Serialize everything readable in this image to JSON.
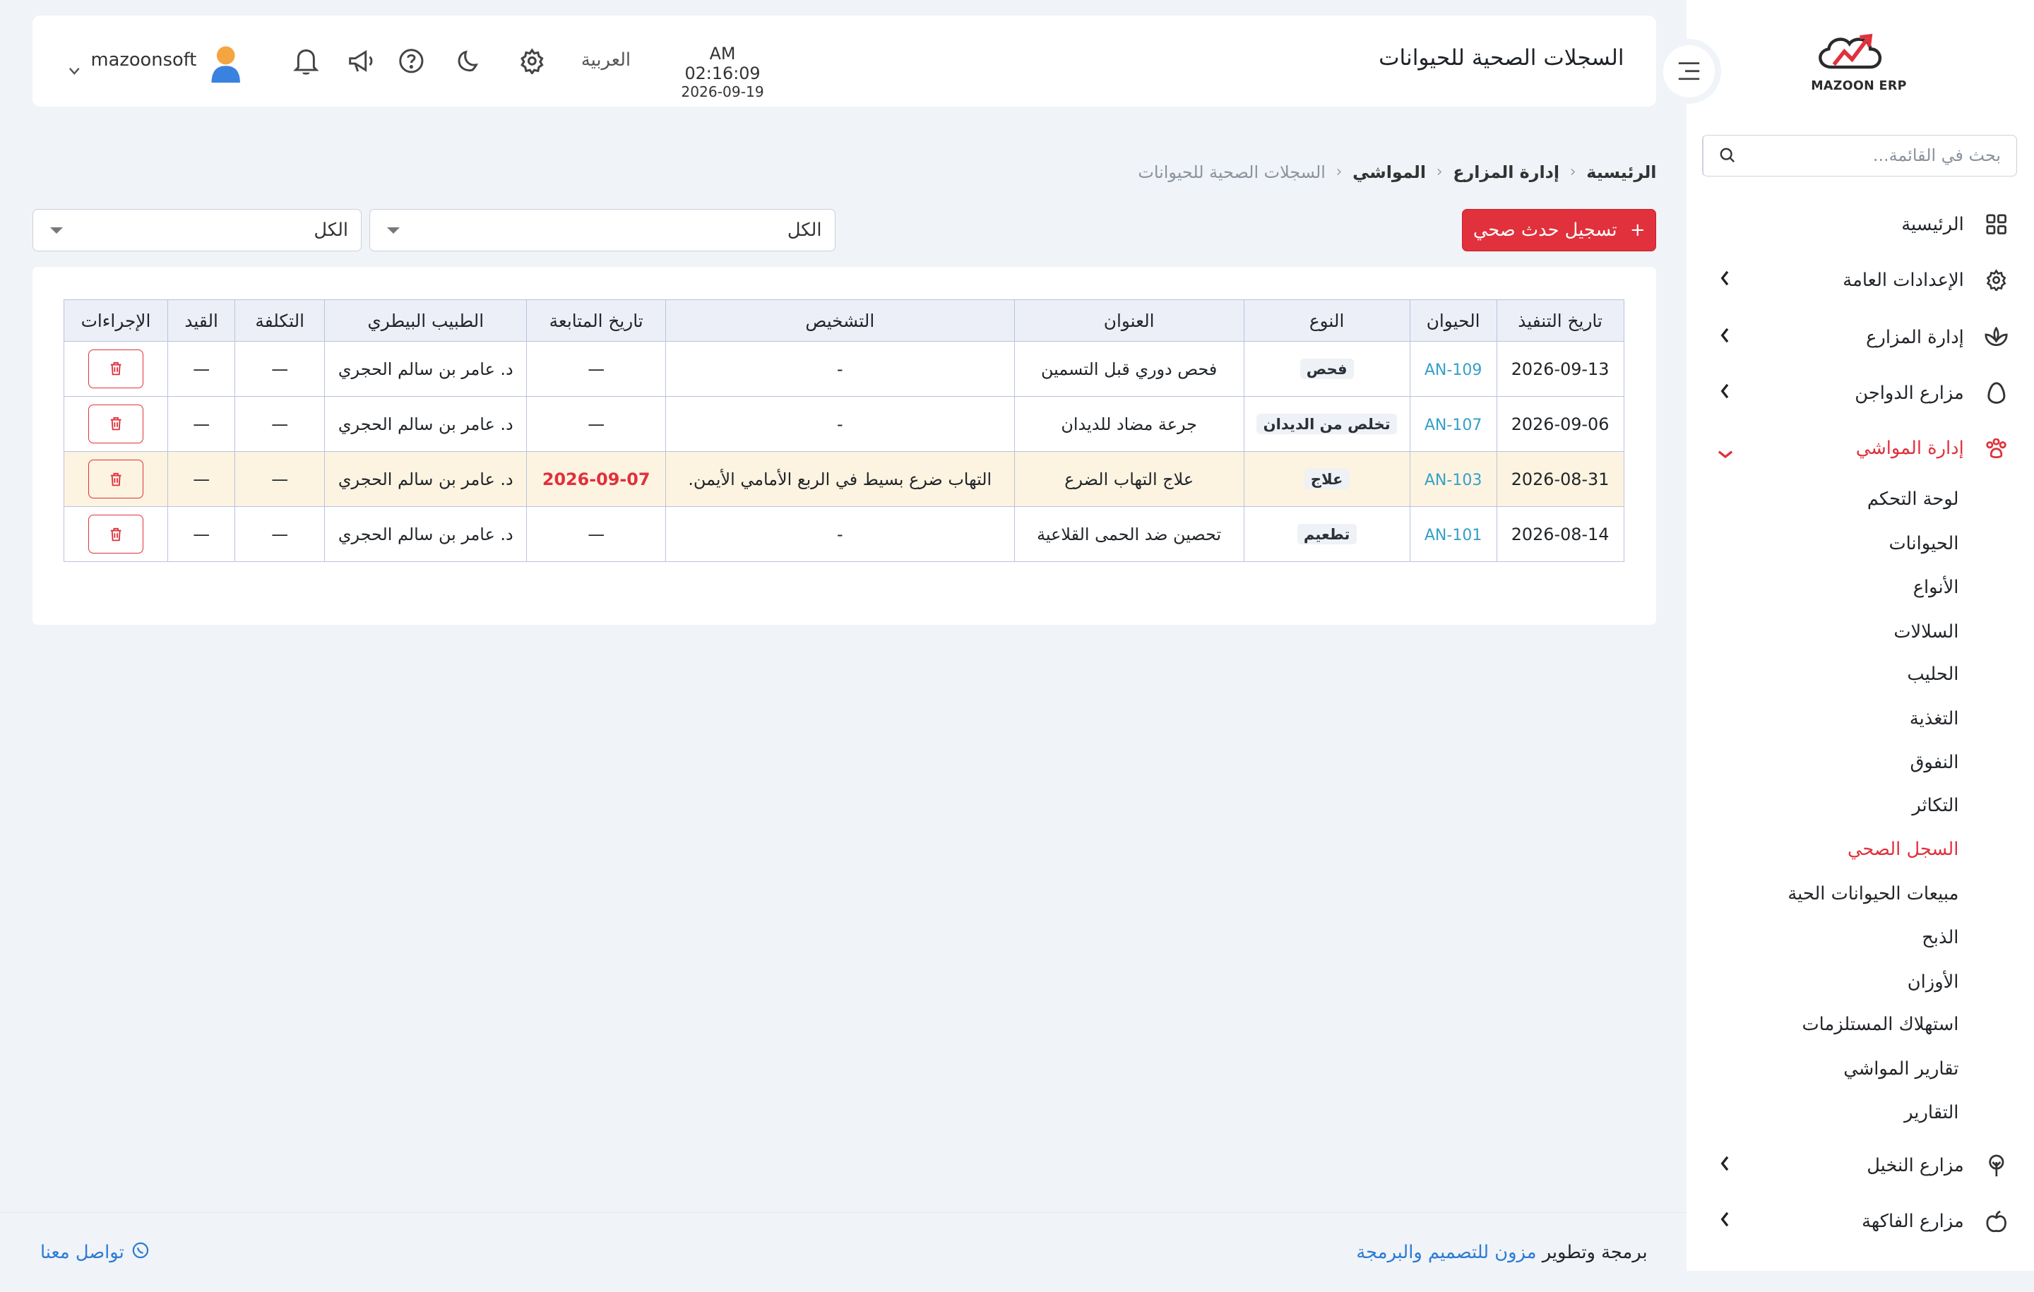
{
  "app": {
    "brand": "MAZOON ERP"
  },
  "header": {
    "title": "السجلات الصحية للحيوانات",
    "time": "AM 02:16:09",
    "date": "2026-09-19",
    "language": "العربية",
    "username": "mazoonsoft"
  },
  "sidebar": {
    "search_placeholder": "بحث في القائمة...",
    "items": [
      {
        "label": "الرئيسية",
        "icon": "grid-icon"
      },
      {
        "label": "الإعدادات العامة",
        "icon": "gear-icon"
      },
      {
        "label": "إدارة المزارع",
        "icon": "leaf-icon"
      },
      {
        "label": "مزارع الدواجن",
        "icon": "egg-icon"
      },
      {
        "label": "إدارة المواشي",
        "icon": "paw-icon"
      },
      {
        "label": "مزارع النخيل",
        "icon": "palm-icon"
      },
      {
        "label": "مزارع الفاكهة",
        "icon": "apple-icon"
      }
    ],
    "sub_items": [
      "لوحة التحكم",
      "الحيوانات",
      "الأنواع",
      "السلالات",
      "الحليب",
      "التغذية",
      "النفوق",
      "التكاثر",
      "السجل الصحي",
      "مبيعات الحيوانات الحية",
      "الذبح",
      "الأوزان",
      "استهلاك المستلزمات",
      "تقارير المواشي",
      "التقارير"
    ]
  },
  "breadcrumb": [
    "الرئيسية",
    "إدارة المزارع",
    "المواشي",
    "السجلات الصحية للحيوانات"
  ],
  "toolbar": {
    "add_label": "تسجيل حدث صحي",
    "filter1": "الكل",
    "filter2": "الكل"
  },
  "table": {
    "headers": [
      "تاريخ التنفيذ",
      "الحيوان",
      "النوع",
      "العنوان",
      "التشخيص",
      "تاريخ المتابعة",
      "الطبيب البيطري",
      "التكلفة",
      "القيد",
      "الإجراءات"
    ],
    "rows": [
      [
        "2026-09-13",
        "AN-109",
        "فحص",
        "فحص دوري قبل التسمين",
        "-",
        "—",
        "د. عامر بن سالم الحجري",
        "—",
        "—"
      ],
      [
        "2026-09-06",
        "AN-107",
        "تخلص من الديدان",
        "جرعة مضاد للديدان",
        "-",
        "—",
        "د. عامر بن سالم الحجري",
        "—",
        "—"
      ],
      [
        "2026-08-31",
        "AN-103",
        "علاج",
        "علاج التهاب الضرع",
        "التهاب ضرع بسيط في الربع الأمامي الأيمن.",
        "2026-09-07",
        "د. عامر بن سالم الحجري",
        "—",
        "—"
      ],
      [
        "2026-08-14",
        "AN-101",
        "تطعيم",
        "تحصين ضد الحمى القلاعية",
        "-",
        "—",
        "د. عامر بن سالم الحجري",
        "—",
        "—"
      ]
    ]
  },
  "footer": {
    "credit_prefix": "برمجة وتطوير",
    "credit_link": "مزون للتصميم والبرمجة",
    "contact": "تواصل معنا"
  },
  "colors": {
    "accent": "#e0313c",
    "link": "#2b7bd3",
    "animal_id": "#35a0c8"
  }
}
